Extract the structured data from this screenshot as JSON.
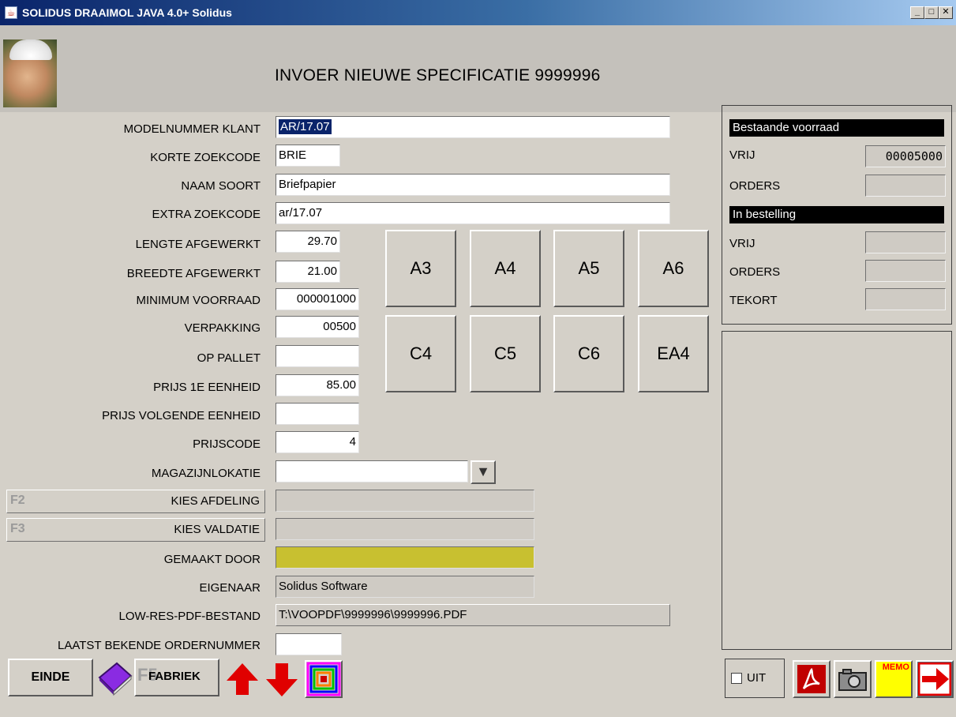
{
  "window": {
    "title": "SOLIDUS DRAAIMOL JAVA 4.0+ Solidus",
    "minimize": "_",
    "maximize": "□",
    "close": "✕"
  },
  "header": {
    "title": "INVOER NIEUWE SPECIFICATIE  9999996"
  },
  "form": {
    "modelnummer": {
      "label": "MODELNUMMER KLANT",
      "value": "AR/17.07"
    },
    "korte_zoekcode": {
      "label": "KORTE ZOEKCODE",
      "value": "BRIE"
    },
    "naam_soort": {
      "label": "NAAM SOORT",
      "value": "Briefpapier"
    },
    "extra_zoekcode": {
      "label": "EXTRA ZOEKCODE",
      "value": "ar/17.07"
    },
    "lengte": {
      "label": "LENGTE AFGEWERKT",
      "value": "29.70"
    },
    "breedte": {
      "label": "BREEDTE AFGEWERKT",
      "value": "21.00"
    },
    "minimum_voorraad": {
      "label": "MINIMUM VOORRAAD",
      "value": "000001000"
    },
    "verpakking": {
      "label": "VERPAKKING",
      "value": "00500"
    },
    "op_pallet": {
      "label": "OP PALLET",
      "value": ""
    },
    "prijs_1e": {
      "label": "PRIJS 1E EENHEID",
      "value": "85.00"
    },
    "prijs_volgende": {
      "label": "PRIJS VOLGENDE EENHEID",
      "value": ""
    },
    "prijscode": {
      "label": "PRIJSCODE",
      "value": "4"
    },
    "magazijnlokatie": {
      "label": "MAGAZIJNLOKATIE",
      "value": "",
      "dropdown_icon": "▼"
    },
    "kies_afdeling": {
      "key": "F2",
      "label": "KIES AFDELING",
      "value": ""
    },
    "kies_valdatie": {
      "key": "F3",
      "label": "KIES VALDATIE",
      "value": ""
    },
    "gemaakt_door": {
      "label": "GEMAAKT DOOR",
      "value": "",
      "color": "#c8c030"
    },
    "eigenaar": {
      "label": "EIGENAAR",
      "value": "Solidus Software"
    },
    "low_res_pdf": {
      "label": "LOW-RES-PDF-BESTAND",
      "value": "T:\\VOOPDF\\9999996\\9999996.PDF"
    },
    "laatst_ordernummer": {
      "label": "LAATST BEKENDE ORDERNUMMER",
      "value": ""
    }
  },
  "format_buttons": [
    "A3",
    "A4",
    "A5",
    "A6",
    "C4",
    "C5",
    "C6",
    "EA4"
  ],
  "stock_panel": {
    "bestaande_header": "Bestaande voorraad",
    "bestaande_vrij_label": "VRIJ",
    "bestaande_vrij_value": "00005000",
    "bestaande_orders_label": "ORDERS",
    "bestaande_orders_value": "",
    "bestelling_header": "In bestelling",
    "bestelling_vrij_label": "VRIJ",
    "bestelling_vrij_value": "",
    "bestelling_orders_label": "ORDERS",
    "bestelling_orders_value": "",
    "tekort_label": "TEKORT",
    "tekort_value": ""
  },
  "toolbar": {
    "einde": "EINDE",
    "fabriek_key": "F5",
    "fabriek": "FABRIEK",
    "uit_label": "UIT",
    "memo_label": "MEMO"
  },
  "colors": {
    "gemaakt_door": "#c8c030",
    "arrow_red": "#e00000",
    "book_purple": "#8a2be2",
    "memo_yellow": "#ffff00"
  }
}
